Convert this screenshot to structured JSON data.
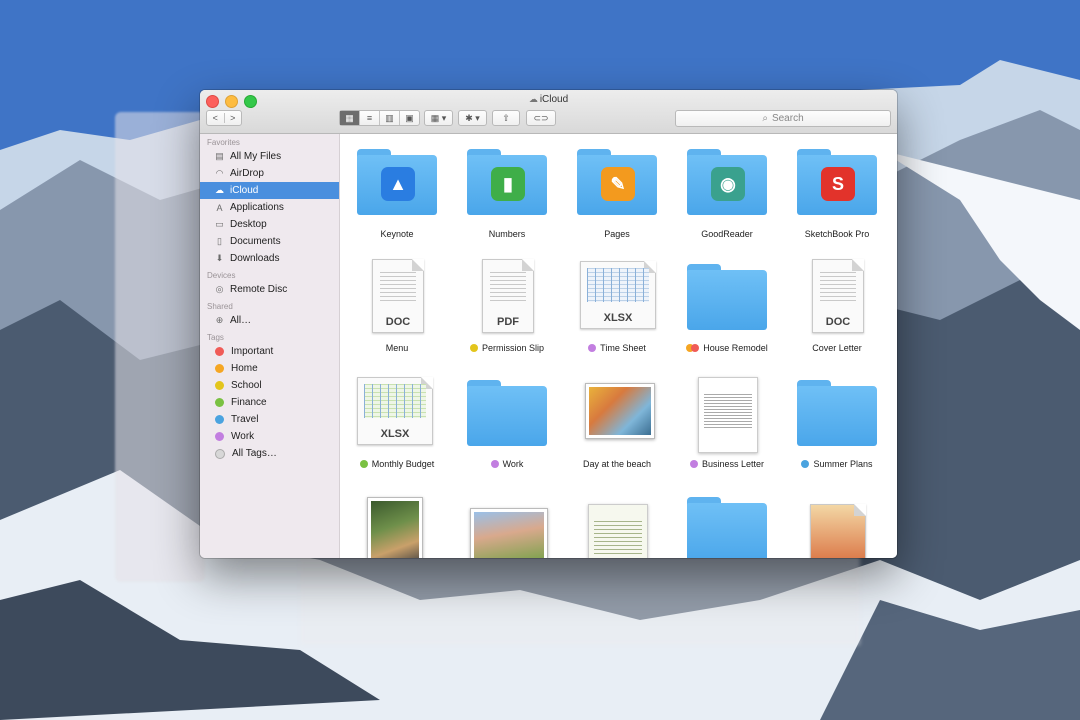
{
  "window": {
    "title": "iCloud"
  },
  "toolbar": {
    "search_placeholder": "Search",
    "back_glyph": "<",
    "forward_glyph": ">"
  },
  "sidebar": {
    "sections": [
      {
        "label": "Favorites",
        "items": [
          {
            "label": "All My Files",
            "icon": "all-files-icon"
          },
          {
            "label": "AirDrop",
            "icon": "airdrop-icon"
          },
          {
            "label": "iCloud",
            "icon": "cloud-icon",
            "selected": true
          },
          {
            "label": "Applications",
            "icon": "applications-icon"
          },
          {
            "label": "Desktop",
            "icon": "desktop-icon"
          },
          {
            "label": "Documents",
            "icon": "documents-icon"
          },
          {
            "label": "Downloads",
            "icon": "downloads-icon"
          }
        ]
      },
      {
        "label": "Devices",
        "items": [
          {
            "label": "Remote Disc",
            "icon": "disc-icon"
          }
        ]
      },
      {
        "label": "Shared",
        "items": [
          {
            "label": "All…",
            "icon": "network-icon"
          }
        ]
      },
      {
        "label": "Tags",
        "items": [
          {
            "label": "Important",
            "color": "#f05b57"
          },
          {
            "label": "Home",
            "color": "#f5a623"
          },
          {
            "label": "School",
            "color": "#e3c51c"
          },
          {
            "label": "Finance",
            "color": "#7ac142"
          },
          {
            "label": "Travel",
            "color": "#4aa3df"
          },
          {
            "label": "Work",
            "color": "#c27ee0"
          },
          {
            "label": "All Tags…",
            "color": "#d7d7d7"
          }
        ]
      }
    ]
  },
  "files": [
    {
      "name": "Keynote",
      "kind": "app-folder",
      "badge_color": "#2a7de1"
    },
    {
      "name": "Numbers",
      "kind": "app-folder",
      "badge_color": "#3fae49"
    },
    {
      "name": "Pages",
      "kind": "app-folder",
      "badge_color": "#f39a1e"
    },
    {
      "name": "GoodReader",
      "kind": "app-folder",
      "badge_color": "#3aa18e"
    },
    {
      "name": "SketchBook Pro",
      "kind": "app-folder",
      "badge_color": "#e2332b"
    },
    {
      "name": "Menu",
      "kind": "doc",
      "ext": "DOC"
    },
    {
      "name": "Permission Slip",
      "kind": "doc",
      "ext": "PDF",
      "tag_color": "#e3c51c"
    },
    {
      "name": "Time Sheet",
      "kind": "sheet",
      "ext": "XLSX",
      "tag_color": "#c27ee0"
    },
    {
      "name": "House Remodel",
      "kind": "folder",
      "tag_colors": [
        "#f5a623",
        "#f05b57"
      ]
    },
    {
      "name": "Cover Letter",
      "kind": "doc",
      "ext": "DOC"
    },
    {
      "name": "Monthly Budget",
      "kind": "sheet",
      "ext": "XLSX",
      "tag_color": "#7ac142"
    },
    {
      "name": "Work",
      "kind": "folder",
      "tag_color": "#c27ee0"
    },
    {
      "name": "Day at the beach",
      "kind": "photo"
    },
    {
      "name": "Business Letter",
      "kind": "letter",
      "tag_color": "#c27ee0"
    },
    {
      "name": "Summer Plans",
      "kind": "folder",
      "tag_color": "#4aa3df"
    }
  ]
}
